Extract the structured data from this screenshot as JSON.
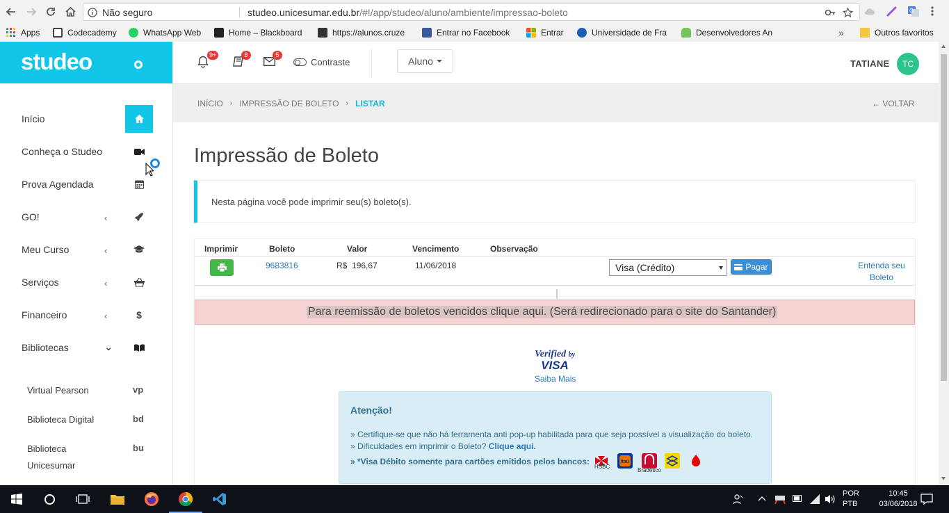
{
  "browser": {
    "security_label": "Não seguro",
    "url_host": "studeo.unicesumar.edu.br",
    "url_path": "/#!/app/studeo/aluno/ambiente/impressao-boleto",
    "bookmarks": [
      {
        "label": "Apps",
        "icon": "apps-grid-icon",
        "color": "#3a7bd5"
      },
      {
        "label": "Codecademy",
        "icon": "codecademy-icon",
        "color": "#444444"
      },
      {
        "label": "WhatsApp Web",
        "icon": "whatsapp-icon",
        "color": "#25d366"
      },
      {
        "label": "Home – Blackboard",
        "icon": "blackboard-icon",
        "color": "#222222"
      },
      {
        "label": "https://alunos.cruze",
        "icon": "cruzeiro-icon",
        "color": "#333333"
      },
      {
        "label": "Entrar no Facebook",
        "icon": "facebook-icon",
        "color": "#3b5998"
      },
      {
        "label": "Entrar",
        "icon": "microsoft-icon",
        "color": "#f25022"
      },
      {
        "label": "Universidade de Fra",
        "icon": "university-icon",
        "color": "#1a5fb4"
      },
      {
        "label": "Desenvolvedores An",
        "icon": "android-icon",
        "color": "#78c257"
      }
    ],
    "other_bookmarks": "Outros favoritos"
  },
  "app": {
    "logo": "studeo",
    "menu": [
      {
        "label": "Início",
        "icon": "home-icon",
        "chevron": ""
      },
      {
        "label": "Conheça o Studeo",
        "icon": "video-camera-icon",
        "chevron": ""
      },
      {
        "label": "Prova Agendada",
        "icon": "calendar-icon",
        "chevron": ""
      },
      {
        "label": "GO!",
        "icon": "rocket-icon",
        "chevron": "‹"
      },
      {
        "label": "Meu Curso",
        "icon": "graduation-cap-icon",
        "chevron": "‹"
      },
      {
        "label": "Serviços",
        "icon": "basket-icon",
        "chevron": "‹"
      },
      {
        "label": "Financeiro",
        "icon": "dollar-icon",
        "chevron": "‹"
      },
      {
        "label": "Bibliotecas",
        "icon": "book-icon",
        "chevron": "⌄"
      }
    ],
    "libraries": [
      {
        "label": "Virtual Pearson",
        "abbr": "vp"
      },
      {
        "label": "Biblioteca Digital",
        "abbr": "bd"
      },
      {
        "label": "Biblioteca Unicesumar",
        "abbr": "bu"
      }
    ],
    "topbar": {
      "notifications_badge": "9+",
      "books_badge": "8",
      "messages_badge": "5",
      "contrast_label": "Contraste",
      "role_dropdown": "Aluno",
      "user_name": "TATIANE",
      "user_initials": "TC"
    },
    "breadcrumb": {
      "home": "INÍCIO",
      "section": "IMPRESSÃO DE BOLETO",
      "current": "LISTAR",
      "back": "VOLTAR"
    },
    "page_title": "Impressão de Boleto",
    "info_text": "Nesta página você pode imprimir seu(s) boleto(s).",
    "table": {
      "headers": [
        "Imprimir",
        "Boleto",
        "Valor",
        "Vencimento",
        "Observação"
      ],
      "rows": [
        {
          "boleto": "9683816",
          "currency": "R$",
          "valor": "196,67",
          "vencimento": "11/06/2018",
          "payment_method": "Visa (Crédito)",
          "pay_label": "Pagar",
          "help_link": "Entenda seu Boleto"
        }
      ]
    },
    "santander_banner": "Para reemissão de boletos vencidos clique aqui. (Será redirecionado para o site do Santander)",
    "verified_by": "Verified",
    "verified_by_small": "by",
    "verified_brand": "VISA",
    "saiba_mais": "Saiba Mais",
    "attention": {
      "title": "Atenção!",
      "line1": "» Certifique-se que não há ferramenta anti pop-up habilitada para que seja possível a visualização do boleto.",
      "line2_prefix": "» Dificuldades em imprimir o Boleto?",
      "line2_link": "Clique aqui.",
      "line3": "» *Visa Débito somente para cartões emitidos pelos bancos:",
      "banks": [
        {
          "name": "HSBC",
          "color": "#db0011"
        },
        {
          "name": "Itaú",
          "color": "#ec7000"
        },
        {
          "name": "Bradesco",
          "color": "#cc092f"
        },
        {
          "name": "Banco do Brasil",
          "color": "#f5d800"
        },
        {
          "name": "Santander",
          "color": "#ec0000"
        }
      ]
    }
  },
  "taskbar": {
    "lang_top": "POR",
    "lang_bottom": "PTB",
    "time": "10:45",
    "date": "03/06/2018"
  },
  "colors": {
    "accent": "#12c6e8",
    "success": "#45b549",
    "primary": "#3c8ed6",
    "danger_bg": "#f6d3d3"
  }
}
